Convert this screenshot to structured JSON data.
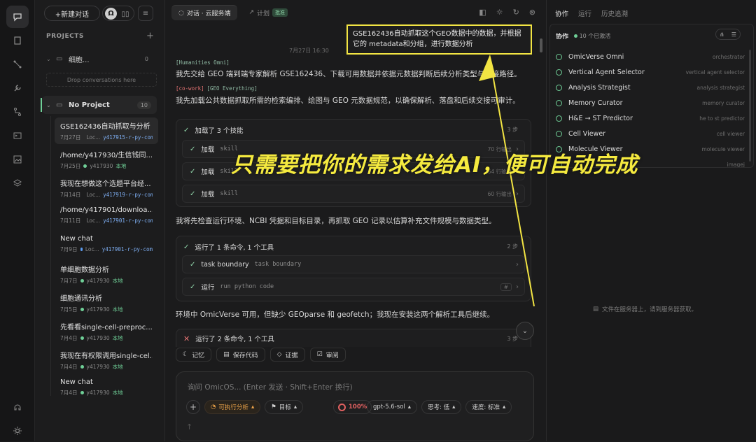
{
  "sidebar": {
    "new_chat": "+新建对话",
    "section": "PROJECTS",
    "group1": {
      "name": "细胞...",
      "count": "0",
      "drop": "Drop conversations here"
    },
    "project": {
      "name": "No Project",
      "count": "10"
    },
    "conversations": [
      {
        "title": "GSE162436自动抓取与分析",
        "date": "7月27日",
        "host": "Loc...",
        "branch": "y417915-r-py-com"
      },
      {
        "title": "/home/y417930/生信钱同...",
        "date": "7月25日",
        "host": "y417930",
        "branch": "本地"
      },
      {
        "title": "我现在想做这个选题平台经...",
        "date": "7月14日",
        "host": "Loc...",
        "branch": "y417919-r-py-com"
      },
      {
        "title": "/home/y417901/downloa...",
        "date": "7月11日",
        "host": "Loc...",
        "branch": "y417901-r-py-com"
      },
      {
        "title": "New chat",
        "date": "7月9日",
        "host": "Loc...",
        "branch": "y417901-r-py-com"
      },
      {
        "title": "单细胞数据分析",
        "date": "7月7日",
        "host": "y417930",
        "branch": "本地"
      },
      {
        "title": "细胞通讯分析",
        "date": "7月5日",
        "host": "y417930",
        "branch": "本地"
      },
      {
        "title": "先看看single-cell-preproc...",
        "date": "7月4日",
        "host": "y417930",
        "branch": "本地"
      },
      {
        "title": "我现在有权限调用single-cel...",
        "date": "7月4日",
        "host": "y417930",
        "branch": "本地"
      },
      {
        "title": "New chat",
        "date": "7月4日",
        "host": "y417930",
        "branch": "本地"
      }
    ]
  },
  "tabs": {
    "chat": "对话 · 云服务端",
    "plan": "计划",
    "plan_badge": "批准"
  },
  "chat": {
    "timestamp": "7月27日 16:30",
    "tag1": "[Humanities Omni]",
    "para1": "我先交给 GEO 端到端专家解析 GSE162436、下载可用数据并依据元数据判断后续分析类型与交接路径。",
    "tag2": "[co-work]",
    "tag2b": "[GEO Everything]",
    "para2": "我先加载公共数据抓取所需的检索编排、绘图与 GEO 元数据规范，以确保解析、落盘和后续交接可审计。",
    "card1": {
      "title": "加载了 3 个技能",
      "steps": "3 步",
      "rows": [
        {
          "label": "加载",
          "mono": "skill",
          "right": "70 行输出"
        },
        {
          "label": "加载",
          "mono": "skill",
          "right": "64 行输出"
        },
        {
          "label": "加载",
          "mono": "skill",
          "right": "60 行输出"
        }
      ]
    },
    "para3": "我将先检查运行环境、NCBI 凭据和目标目录，再抓取 GEO 记录以估算补充文件规模与数据类型。",
    "card2": {
      "title": "运行了 1 条命令, 1 个工具",
      "steps": "2 步",
      "rows": [
        {
          "label": "task boundary",
          "mono": "task boundary",
          "right": ""
        },
        {
          "label": "运行",
          "mono": "run python code",
          "right": "#"
        }
      ]
    },
    "para4": "环境中 OmicVerse 可用，但缺少 GEOparse 和 geofetch；我现在安装这两个解析工具后继续。",
    "card3": {
      "title": "运行了 2 条命令, 1 个工具",
      "steps": "3 步"
    },
    "actions": [
      "记忆",
      "保存代码",
      "证据",
      "审阅"
    ]
  },
  "composer": {
    "placeholder": "询问 OmicOS... (Enter 发送 · Shift+Enter 换行)",
    "mode": "可执行分析",
    "target": "目标",
    "percent": "100%",
    "model": "gpt-5.6-sol",
    "think": "思考: 低",
    "speed": "速度: 标准"
  },
  "right": {
    "tabs": [
      "协作",
      "运行",
      "历史追溯"
    ],
    "title": "协作",
    "active": "10 个已激活",
    "agents": [
      {
        "name": "OmicVerse Omni",
        "sub": "orchestrator"
      },
      {
        "name": "Vertical Agent Selector",
        "sub": "vertical agent selector"
      },
      {
        "name": "Analysis Strategist",
        "sub": "analysis strategist"
      },
      {
        "name": "Memory Curator",
        "sub": "memory curator"
      },
      {
        "name": "H&E → ST Predictor",
        "sub": "he to st predictor"
      },
      {
        "name": "Cell Viewer",
        "sub": "cell viewer"
      },
      {
        "name": "Molecule Viewer",
        "sub": "molecule viewer"
      },
      {
        "name": "",
        "sub": "imagej"
      }
    ],
    "empty": "文件在服务器上，请到服务器获取。"
  },
  "annotation": {
    "callout": "GSE162436自动抓取这个GEO数据中的数据，并根据它的 metadata和分组，进行数据分析",
    "headline": "只需要把你的需求发给AI，便可自动完成",
    "color": "#f2e443"
  }
}
